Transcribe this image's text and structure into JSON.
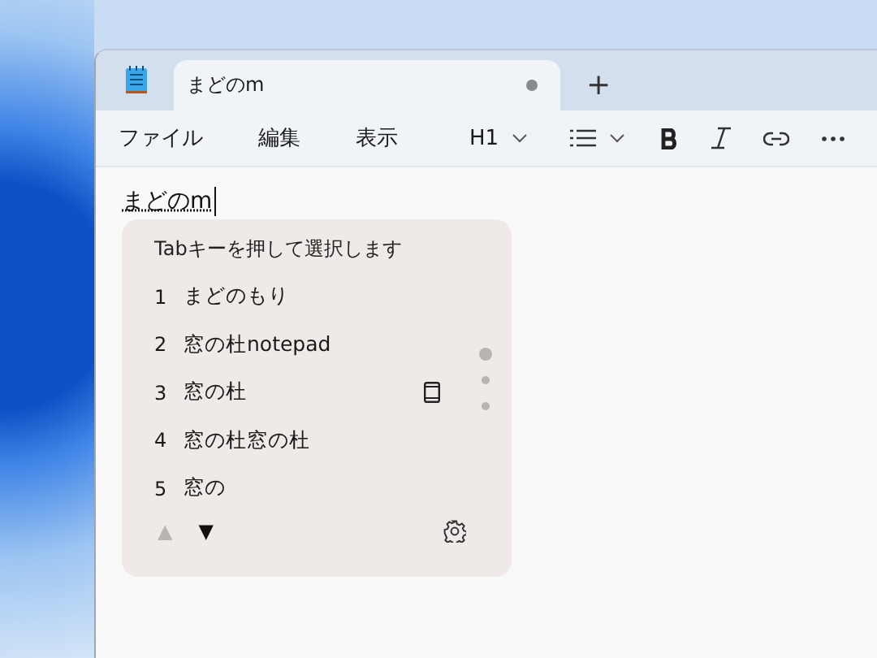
{
  "tab": {
    "title": "まどのm",
    "unsaved": true
  },
  "new_tab": "+",
  "menu": [
    "ファイル",
    "編集",
    "表示"
  ],
  "toolbar": {
    "heading": "H1"
  },
  "document": {
    "text": "まどのm"
  },
  "ime": {
    "hint": "Tabキーを押して選択します",
    "candidates": [
      {
        "number": "1",
        "text": "まどのもり",
        "dictionary": false
      },
      {
        "number": "2",
        "text": "窓の杜notepad",
        "dictionary": false
      },
      {
        "number": "3",
        "text": "窓の杜",
        "dictionary": true
      },
      {
        "number": "4",
        "text": "窓の杜窓の杜",
        "dictionary": false
      },
      {
        "number": "5",
        "text": "窓の",
        "dictionary": false
      }
    ],
    "page_up": {
      "glyph": "▲",
      "disabled": true
    },
    "page_down": {
      "glyph": "▼",
      "disabled": false
    }
  }
}
